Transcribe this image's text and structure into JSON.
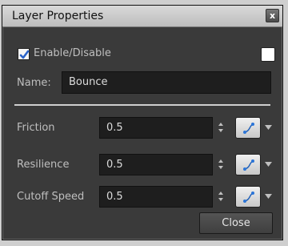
{
  "window": {
    "title": "Layer Properties",
    "close_glyph": "x"
  },
  "enable": {
    "label": "Enable/Disable",
    "checked": true,
    "swatch_color": "#ffffff"
  },
  "name": {
    "label": "Name:",
    "value": "Bounce"
  },
  "properties": [
    {
      "label": "Friction",
      "value": "0.5"
    },
    {
      "label": "Resilience",
      "value": "0.5"
    },
    {
      "label": "Cutoff Speed",
      "value": "0.5"
    }
  ],
  "footer": {
    "close_label": "Close"
  },
  "icons": {
    "checkbox": "checkmark-icon",
    "spinner": "up-down-arrows-icon",
    "function": "function-curve-icon",
    "menu": "chevron-down-icon"
  },
  "colors": {
    "accent": "#3a7bd5",
    "panel": "#3a3a3a",
    "field": "#1e1e1e"
  }
}
